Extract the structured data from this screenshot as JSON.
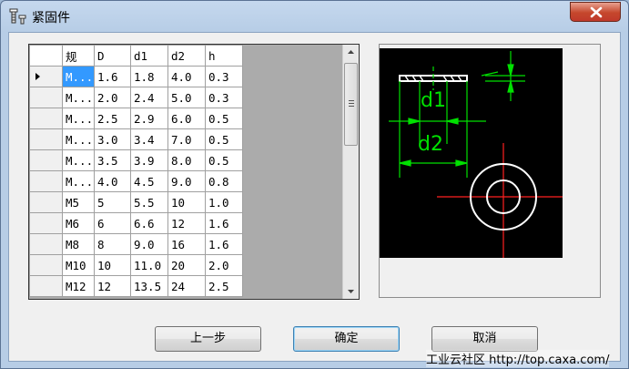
{
  "window": {
    "title": "紧固件",
    "icon": "fastener-app-icon",
    "close_icon": "close-icon"
  },
  "grid": {
    "columns": [
      "规",
      "D",
      "d1",
      "d2",
      "h"
    ],
    "rows": [
      [
        "M...",
        "1.6",
        "1.8",
        "4.0",
        "0.3"
      ],
      [
        "M...",
        "2.0",
        "2.4",
        "5.0",
        "0.3"
      ],
      [
        "M...",
        "2.5",
        "2.9",
        "6.0",
        "0.5"
      ],
      [
        "M...",
        "3.0",
        "3.4",
        "7.0",
        "0.5"
      ],
      [
        "M...",
        "3.5",
        "3.9",
        "8.0",
        "0.5"
      ],
      [
        "M...",
        "4.0",
        "4.5",
        "9.0",
        "0.8"
      ],
      [
        "M5",
        "5",
        "5.5",
        "10",
        "1.0"
      ],
      [
        "M6",
        "6",
        "6.6",
        "12",
        "1.6"
      ],
      [
        "M8",
        "8",
        "9.0",
        "16",
        "1.6"
      ],
      [
        "M10",
        "10",
        "11.0",
        "20",
        "2.0"
      ],
      [
        "M12",
        "12",
        "13.5",
        "24",
        "2.5"
      ]
    ],
    "selected_row": 0
  },
  "preview": {
    "labels": {
      "d1": "d1",
      "d2": "d2"
    },
    "colors": {
      "background": "#000000",
      "geometry": "#ffffff",
      "dimensions": "#00ff00",
      "centerline": "#ff0000"
    }
  },
  "buttons": {
    "prev": "上一步",
    "ok": "确定",
    "cancel": "取消"
  },
  "watermark": "工业云社区 http://top.caxa.com/"
}
